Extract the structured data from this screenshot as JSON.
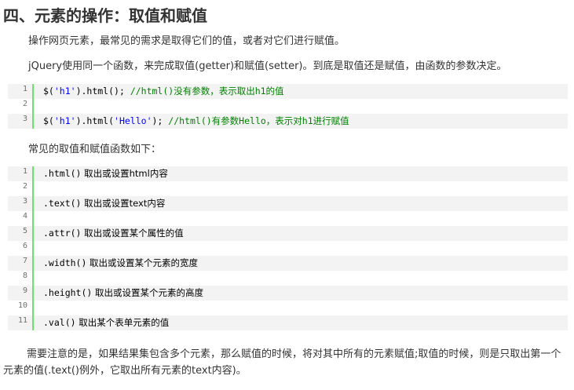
{
  "heading": "四、元素的操作：取值和赋值",
  "intro": "操作网页元素，最常见的需求是取得它们的值，或者对它们进行赋值。",
  "jquery_para": "jQuery使用同一个函数，来完成取值(getter)和赋值(setter)。到底是取值还是赋值，由函数的参数决定。",
  "code1": {
    "lines": [
      {
        "num": "1",
        "pre": "$(",
        "str": "'h1'",
        "post": ").html(); ",
        "comment": "//html()没有参数，表示取出h1的值"
      },
      {
        "num": "2",
        "pre": "",
        "str": "",
        "post": "",
        "comment": ""
      },
      {
        "num": "3",
        "pre": "$(",
        "str": "'h1'",
        "post": ").html(",
        "str2": "'Hello'",
        "post2": "); ",
        "comment": "//html()有参数Hello，表示对h1进行赋值"
      }
    ]
  },
  "common_para": "常见的取值和赋值函数如下：",
  "code2": {
    "lines": [
      {
        "num": "1",
        "code": ".html()",
        "text": " 取出或设置html内容"
      },
      {
        "num": "2",
        "code": "",
        "text": ""
      },
      {
        "num": "3",
        "code": ".text()",
        "text": " 取出或设置text内容"
      },
      {
        "num": "4",
        "code": "",
        "text": ""
      },
      {
        "num": "5",
        "code": ".attr()",
        "text": " 取出或设置某个属性的值"
      },
      {
        "num": "6",
        "code": "",
        "text": ""
      },
      {
        "num": "7",
        "code": ".width()",
        "text": " 取出或设置某个元素的宽度"
      },
      {
        "num": "8",
        "code": "",
        "text": ""
      },
      {
        "num": "9",
        "code": ".height()",
        "text": " 取出或设置某个元素的高度"
      },
      {
        "num": "10",
        "code": "",
        "text": ""
      },
      {
        "num": "11",
        "code": ".val()",
        "text": " 取出某个表单元素的值"
      }
    ]
  },
  "note_para": "需要注意的是，如果结果集包含多个元素，那么赋值的时候，将对其中所有的元素赋值;取值的时候，则是只取出第一个元素的值(.text()例外，它取出所有元素的text内容)。",
  "colors": {
    "gutter_border": "#6ce26c",
    "alt_row": "#f3f3f3",
    "string": "#0000ff",
    "comment": "#008200"
  }
}
